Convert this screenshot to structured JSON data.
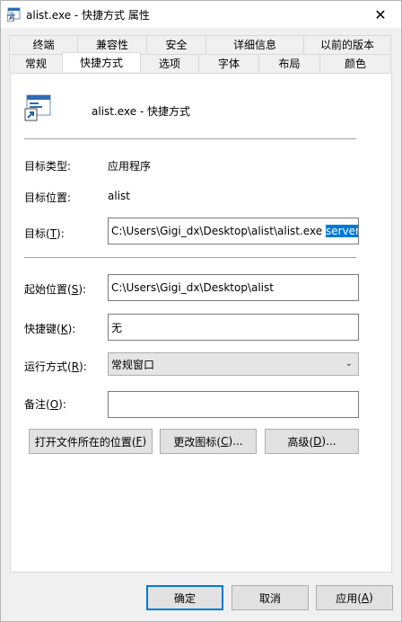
{
  "window": {
    "title": "alist.exe - 快捷方式 属性",
    "close_icon": "close-icon"
  },
  "tabs": {
    "row1": [
      "终端",
      "兼容性",
      "安全",
      "详细信息",
      "以前的版本"
    ],
    "row2": [
      "常规",
      "快捷方式",
      "选项",
      "字体",
      "布局",
      "颜色"
    ],
    "active": "快捷方式"
  },
  "shortcut": {
    "name": "alist.exe - 快捷方式",
    "target_type_label": "目标类型:",
    "target_type_value": "应用程序",
    "target_location_label": "目标位置:",
    "target_location_value": "alist",
    "target_label_pre": "目标(",
    "target_label_key": "T",
    "target_label_post": "):",
    "target_value": "C:\\Users\\Gigi_dx\\Desktop\\alist\\alist.exe ",
    "target_selected": "server",
    "start_in_label_pre": "起始位置(",
    "start_in_label_key": "S",
    "start_in_label_post": "):",
    "start_in_value": "C:\\Users\\Gigi_dx\\Desktop\\alist",
    "hotkey_label_pre": "快捷键(",
    "hotkey_label_key": "K",
    "hotkey_label_post": "):",
    "hotkey_value": "无",
    "run_label_pre": "运行方式(",
    "run_label_key": "R",
    "run_label_post": "):",
    "run_value": "常规窗口",
    "comment_label_pre": "备注(",
    "comment_label_key": "O",
    "comment_label_post": "):",
    "comment_value": ""
  },
  "buttons": {
    "open_location_pre": "打开文件所在的位置(",
    "open_location_key": "F",
    "open_location_post": ")",
    "change_icon_pre": "更改图标(",
    "change_icon_key": "C",
    "change_icon_post": ")...",
    "advanced_pre": "高级(",
    "advanced_key": "D",
    "advanced_post": ")...",
    "ok": "确定",
    "cancel": "取消",
    "apply_pre": "应用(",
    "apply_key": "A",
    "apply_post": ")"
  },
  "colors": {
    "accent": "#0078d7",
    "panel_bg": "#ffffff",
    "window_bg": "#f0f0f0"
  }
}
